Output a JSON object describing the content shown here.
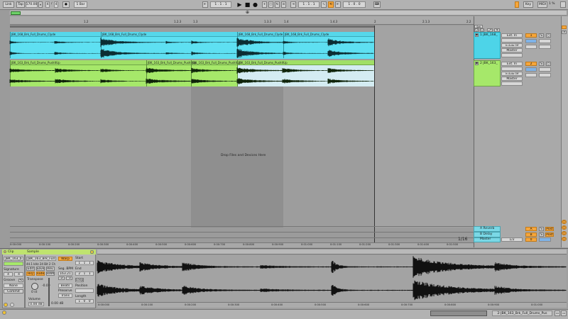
{
  "transport": {
    "link": "Link",
    "tap": "Tap",
    "tempo": "170.00",
    "time_sig_num": "4",
    "time_sig_den": "4",
    "metronome": "●",
    "quantize": "1 Bar",
    "arrangement_position": "1 . 1 . 1",
    "loop_start": "1 . 1 . 1",
    "loop_length": "1 . 0 . 0",
    "key": "Key",
    "midi": "MIDI",
    "cpu": "1 %"
  },
  "ruler": {
    "bar_labels": [
      "1.2",
      "1.2.3",
      "1.3",
      "1.3.3",
      "1.4",
      "1.4.3",
      "2",
      "2.1.3",
      "2.2"
    ],
    "time_labels": [
      "0:00:000",
      "0:00:100",
      "0:00:200",
      "0:00:300",
      "0:00:400",
      "0:00:500",
      "0:00:600",
      "0:00:700",
      "0:00:800",
      "0:00:900",
      "0:01:000",
      "0:01:100",
      "0:01:200",
      "0:01:300",
      "0:01:400",
      "0:01:500"
    ]
  },
  "tracks": [
    {
      "name": "1 JBK_168_",
      "color": "#4dd4e8",
      "clip_color": "#5ee0f2",
      "clips": [
        "JBK_168_Brk_Full_Drums_Clyde",
        "JBK_168_Brk_Full_Drums_Clyde",
        "JBK_168_Brk_Full_Drums_Clyde",
        "JBK_168_Brk_Full_Drums_Clyde"
      ],
      "input_type": "Ext. In",
      "input_channel": "1",
      "monitor": "In Auto Off",
      "output": "Master",
      "track_number": "1",
      "solo": "S"
    },
    {
      "name": "2 JBK_163_",
      "color": "#a6e86a",
      "clip_color": "#b4ec7c",
      "clips": [
        "JBK_163_Brk_Full_Drums_PushItUp",
        "JBK_163_Brk_Full_Drums_PushItUp",
        "JBK_163_Brk_Full_Drums_PushItUp",
        "JBK_163_Brk_Full_Drums_PushItUp"
      ],
      "input_type": "Ext. In",
      "input_channel": "2",
      "monitor": "In Auto Off",
      "output": "Master",
      "track_number": "2",
      "solo": "S"
    }
  ],
  "drop_hint": "Drop Files and Devices Here",
  "zoom_display": "1/16",
  "returns": [
    {
      "name": "A Reverb",
      "letter": "A",
      "solo": "S",
      "send": "Post"
    },
    {
      "name": "B Delay",
      "letter": "B",
      "solo": "S",
      "send": "Post"
    }
  ],
  "master": {
    "name": "Master",
    "value": "1/2",
    "number": "0"
  },
  "clip_view": {
    "clip_tab": "Clip",
    "sample_tab": "Sample",
    "clip_name": "JBK_163_b",
    "sample_name": "JBK_163_Brk_Full",
    "sample_info": "44.1 kHz 24 Bit 2 Ch",
    "edit": "Edit",
    "save": "Save",
    "rev": "Rev.",
    "hiq": "HiQ",
    "fade": "Fade",
    "ram": "RAM",
    "signature": "Signature",
    "sig_num": "4",
    "sig_den": "4",
    "groove": "Groove",
    "groove_value": "None",
    "commit": "Commit",
    "transpose": "Transpose",
    "transpose_value": "0 st",
    "volume": "Volume",
    "volume_value": "0.00 dB",
    "detune": "-0.00",
    "warp": "Warp",
    "seg_bpm": "Seg. BPM",
    "seg_bpm_value": "163.21",
    "beats": "Beats",
    "preserve": "Preserve",
    "trans": "Trans",
    "start": "Start",
    "end": "End",
    "loop": "Loop",
    "position": "Position",
    "length": "Length",
    "length_value": "1 . 0 . 0",
    "start_value": "1 . 1 . 1",
    "end_value": "2 . 1 . 1",
    "time_labels": [
      "0:00:000",
      "0:00:100",
      "0:00:200",
      "0:00:300",
      "0:00:400",
      "0:00:500",
      "0:00:600",
      "0:00:700",
      "0:00:800",
      "0:00:900",
      "0:01:000",
      "0:01:100"
    ]
  },
  "status_bar": "2-JBK_163_Brk_Full_Drums_Pus"
}
